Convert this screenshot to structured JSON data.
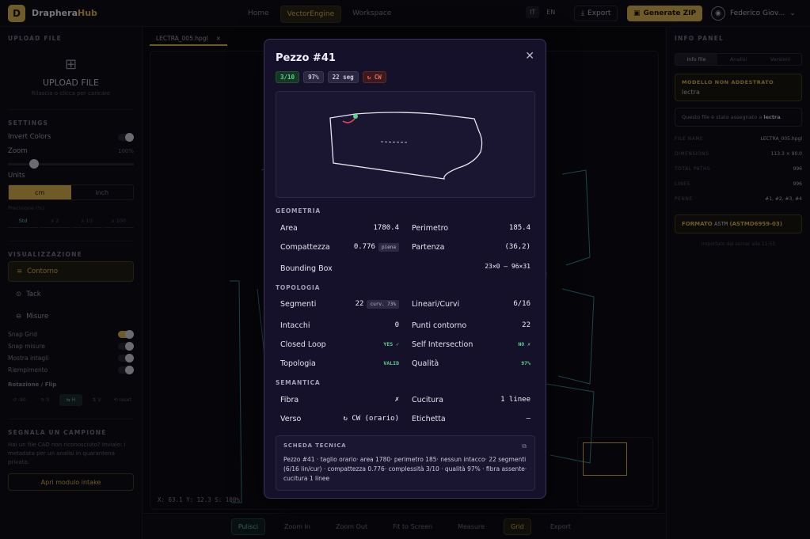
{
  "topbar": {
    "logo_letter": "D",
    "brand_a": "Draphera",
    "brand_b": "Hub",
    "nav": [
      "Home",
      "VectorEngine",
      "Workspace"
    ],
    "lang": [
      "IT",
      "EN"
    ],
    "export_label": "Export",
    "generate_label": "Generate ZIP",
    "user_name": "Federico Giov..."
  },
  "left": {
    "upload_title": "UPLOAD FILE",
    "upload_label": "UPLOAD FILE",
    "upload_sub": "Rilascia o clicca per caricare",
    "settings_title": "SETTINGS",
    "invert_label": "Invert Colors",
    "zoom_label": "Zoom",
    "zoom_value": "100%",
    "units_label": "Units",
    "unit_cm": "cm",
    "unit_inch": "inch",
    "precision_label": "Precisione (%)",
    "precision_opts": [
      "Std",
      "x 2",
      "x 10",
      "x 100"
    ],
    "vis_title": "VISUALIZZAZIONE",
    "vis_items": [
      "Contorno",
      "Tack",
      "Misure"
    ],
    "snap_grid": "Snap Grid",
    "snap_misure": "Snap misure",
    "mostra_intagli": "Mostra intagli",
    "riempimento": "Riempimento",
    "rot_label": "Rotazione / Flip",
    "rot_opts": [
      "↺ -90",
      "↻ 0",
      "⇆ H",
      "⇅ V",
      "⟲ reset"
    ],
    "camp_title": "SEGNALA UN CAMPIONE",
    "camp_text": "Hai un file CAD non riconosciuto? Invialo: i metadata per un analisi in quarantena privata.",
    "intake_label": "Apri modulo intake"
  },
  "canvas": {
    "tab_name": "LECTRA_005.hpgl",
    "coords": "X: 63.1   Y: 12.3   S: 100%",
    "toolbar": [
      "Pulisci",
      "Zoom In",
      "Zoom Out",
      "Fit to Screen",
      "Measure",
      "Grid",
      "Export"
    ]
  },
  "right": {
    "title": "INFO PANEL",
    "tabs": [
      "Info file",
      "Analisi",
      "Versioni"
    ],
    "model_title": "MODELLO NON ADDESTRATO",
    "model_value": "lectra",
    "info_text_a": "Questo file è stato assegnato a",
    "info_text_b": "lectra",
    "kv": [
      {
        "k": "FILE NAME",
        "v": "LECTRA_005.hpgl"
      },
      {
        "k": "DIMENSIONS",
        "v": "113.3 × 90.0"
      },
      {
        "k": "TOTAL PATHS",
        "v": "996"
      },
      {
        "k": "LINES",
        "v": "996"
      },
      {
        "k": "PENNE",
        "v": "#1, #2, #3, #4"
      }
    ],
    "format_label": "FORMATO",
    "format_value": "ASTM",
    "format_code": "(ASTMD6959-03)",
    "note": "Importato dal server alle 11:55"
  },
  "modal": {
    "title": "Pezzo #41",
    "close": "✕",
    "badges": [
      {
        "text": "3/10",
        "kind": "green"
      },
      {
        "text": "97%",
        "kind": "gray"
      },
      {
        "text": "22 seg",
        "kind": "gray"
      },
      {
        "text": "↻ CW",
        "kind": "red"
      }
    ],
    "geometria": {
      "title": "GEOMETRIA",
      "area_label": "Area",
      "area_value": "1780.4",
      "perimetro_label": "Perimetro",
      "perimetro_value": "185.4",
      "compattezza_label": "Compattezza",
      "compattezza_value": "0.776",
      "compattezza_chip": "piena",
      "partenza_label": "Partenza",
      "partenza_value": "(36,2)",
      "bbox_label": "Bounding Box",
      "bbox_value": "23×0 – 96×31"
    },
    "topologia": {
      "title": "TOPOLOGIA",
      "segmenti_label": "Segmenti",
      "segmenti_value": "22",
      "segmenti_chip": "curv. 73%",
      "lineari_label": "Lineari/Curvi",
      "lineari_value": "6/16",
      "intacchi_label": "Intacchi",
      "intacchi_value": "0",
      "punti_label": "Punti contorno",
      "punti_value": "22",
      "closed_label": "Closed Loop",
      "closed_value": "YES ✓",
      "self_label": "Self Intersection",
      "self_value": "NO ✗",
      "topologia_label": "Topologia",
      "topologia_value": "VALID",
      "qualita_label": "Qualità",
      "qualita_value": "97%"
    },
    "semantica": {
      "title": "SEMANTICA",
      "fibra_label": "Fibra",
      "fibra_value": "✗",
      "cucitura_label": "Cucitura",
      "cucitura_value": "1 linee",
      "verso_label": "Verso",
      "verso_value": "↻ CW (orario)",
      "etichetta_label": "Etichetta",
      "etichetta_value": "—"
    },
    "sheet": {
      "title": "SCHEDA TECNICA",
      "body": "Pezzo #41 · taglio orario· area 1780· perimetro 185· nessun intacco· 22 segmenti (6/16 lin/cur) · compattezza 0.776· complessità 3/10 · qualità 97% · fibra assente· cucitura 1 linee"
    }
  },
  "colors": {
    "accent": "#e6b53c",
    "modal_bg": "#15112a",
    "ok": "#59d48f",
    "warn": "#e36b5d",
    "outline": "#3ec6c6"
  }
}
